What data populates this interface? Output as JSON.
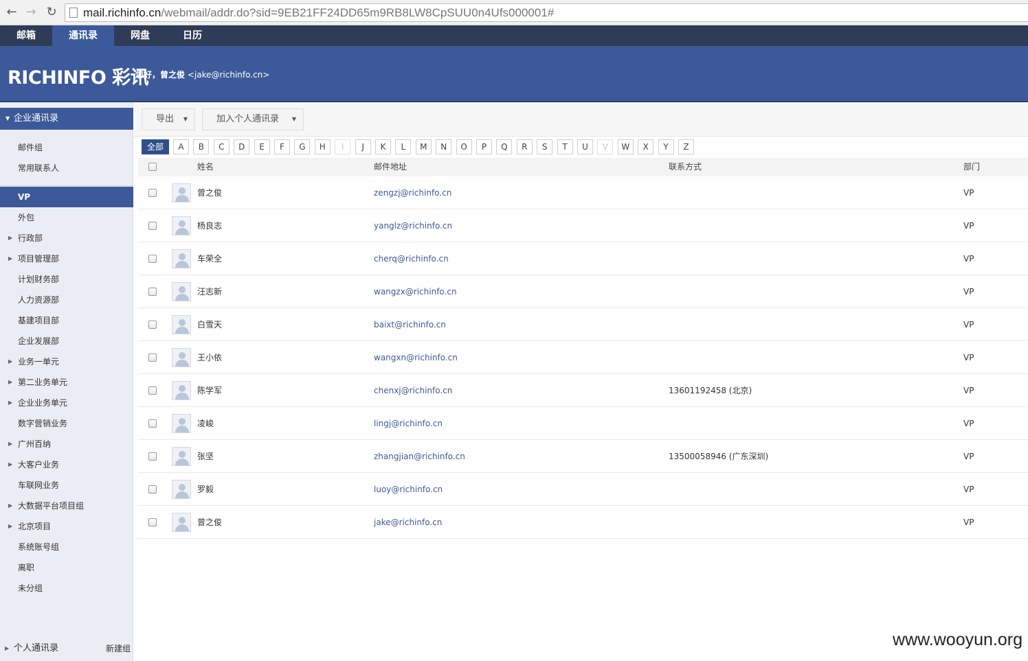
{
  "browser": {
    "url_host": "mail.richinfo.cn",
    "url_path": "/webmail/addr.do?sid=9EB21FF24DD65m9RB8LW8CpSUU0n4Ufs000001#"
  },
  "app_nav": [
    "邮箱",
    "通讯录",
    "网盘",
    "日历"
  ],
  "header": {
    "logo": "RICHINFO 彩讯",
    "greeting_prefix": "您好，曾之俊",
    "greeting_email": "<jake@richinfo.cn>"
  },
  "sidebar": {
    "section_title": "企业通讯录",
    "top_items": [
      "邮件组",
      "常用联系人"
    ],
    "groups": [
      {
        "label": "VP",
        "expandable": false,
        "active": true
      },
      {
        "label": "外包",
        "expandable": false
      },
      {
        "label": "行政部",
        "expandable": true
      },
      {
        "label": "项目管理部",
        "expandable": true
      },
      {
        "label": "计划财务部",
        "expandable": false
      },
      {
        "label": "人力资源部",
        "expandable": false
      },
      {
        "label": "基建项目部",
        "expandable": false
      },
      {
        "label": "企业发展部",
        "expandable": false
      },
      {
        "label": "业务一单元",
        "expandable": true
      },
      {
        "label": "第二业务单元",
        "expandable": true
      },
      {
        "label": "企业业务单元",
        "expandable": true
      },
      {
        "label": "数字营销业务",
        "expandable": false
      },
      {
        "label": "广州百纳",
        "expandable": true
      },
      {
        "label": "大客户业务",
        "expandable": true
      },
      {
        "label": "车联网业务",
        "expandable": false
      },
      {
        "label": "大数据平台项目组",
        "expandable": true
      },
      {
        "label": "北京项目",
        "expandable": true
      },
      {
        "label": "系统账号组",
        "expandable": false
      },
      {
        "label": "离职",
        "expandable": false
      },
      {
        "label": "未分组",
        "expandable": false
      }
    ],
    "footer_label": "个人通讯录",
    "footer_action": "新建组"
  },
  "toolbar": {
    "export_label": "导出",
    "add_personal_label": "加入个人通讯录"
  },
  "letter_filter": [
    "全部",
    "A",
    "B",
    "C",
    "D",
    "E",
    "F",
    "G",
    "H",
    "I",
    "J",
    "K",
    "L",
    "M",
    "N",
    "O",
    "P",
    "Q",
    "R",
    "S",
    "T",
    "U",
    "V",
    "W",
    "X",
    "Y",
    "Z"
  ],
  "letter_active": "全部",
  "letter_disabled": [
    "I",
    "V"
  ],
  "table": {
    "columns": {
      "name": "姓名",
      "email": "邮件地址",
      "phone": "联系方式",
      "dept": "部门"
    },
    "rows": [
      {
        "name": "曾之俊",
        "email": "zengzj@richinfo.cn",
        "phone": "",
        "dept": "VP"
      },
      {
        "name": "杨良志",
        "email": "yanglz@richinfo.cn",
        "phone": "",
        "dept": "VP"
      },
      {
        "name": "车荣全",
        "email": "cherq@richinfo.cn",
        "phone": "",
        "dept": "VP"
      },
      {
        "name": "汪志新",
        "email": "wangzx@richinfo.cn",
        "phone": "",
        "dept": "VP"
      },
      {
        "name": "白雪天",
        "email": "baixt@richinfo.cn",
        "phone": "",
        "dept": "VP"
      },
      {
        "name": "王小依",
        "email": "wangxn@richinfo.cn",
        "phone": "",
        "dept": "VP"
      },
      {
        "name": "陈学军",
        "email": "chenxj@richinfo.cn",
        "phone": "13601192458 (北京)",
        "dept": "VP"
      },
      {
        "name": "凌峻",
        "email": "lingj@richinfo.cn",
        "phone": "",
        "dept": "VP"
      },
      {
        "name": "张坚",
        "email": "zhangjian@richinfo.cn",
        "phone": "13500058946 (广东深圳)",
        "dept": "VP"
      },
      {
        "name": "罗毅",
        "email": "luoy@richinfo.cn",
        "phone": "",
        "dept": "VP"
      },
      {
        "name": "曾之俊",
        "email": "jake@richinfo.cn",
        "phone": "",
        "dept": "VP"
      }
    ]
  },
  "watermark": "www.wooyun.org"
}
